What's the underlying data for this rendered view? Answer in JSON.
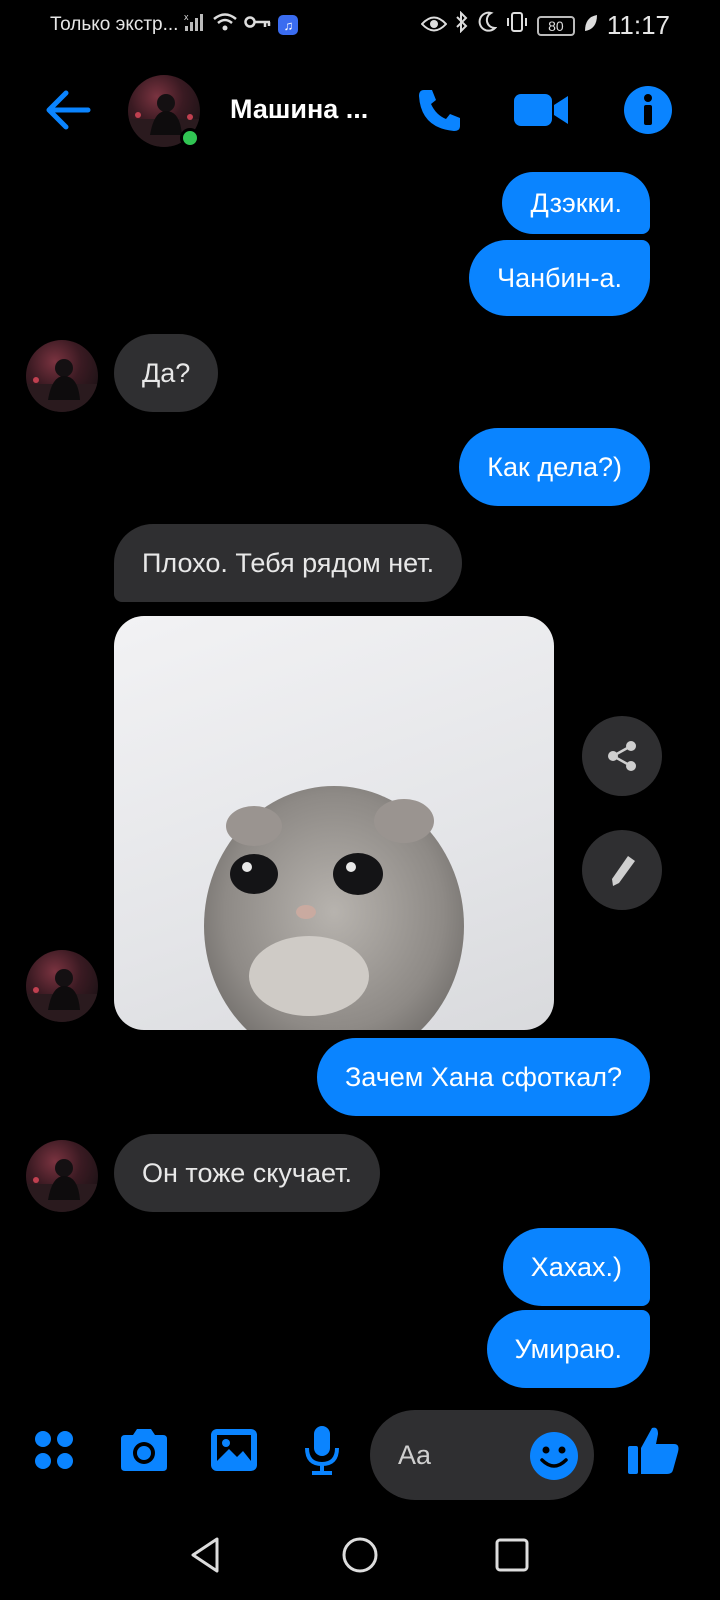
{
  "status": {
    "carrier": "Только экстр...",
    "time": "11:17",
    "battery": "80"
  },
  "header": {
    "contact_name": "Машина ..."
  },
  "messages": {
    "m1": "Дзэкки.",
    "m2": "Чанбин-а.",
    "m3": "Да?",
    "m4": "Как дела?)",
    "m5": "Плохо. Тебя рядом нет.",
    "m6": "Зачем Хана сфоткал?",
    "m7": "Он тоже скучает.",
    "m8": "Хахах.)",
    "m9": "Умираю."
  },
  "composer": {
    "placeholder": "Aa"
  },
  "colors": {
    "accent": "#0a84ff",
    "incoming_bubble": "#2f2f31",
    "background": "#000000",
    "online": "#31c553"
  }
}
